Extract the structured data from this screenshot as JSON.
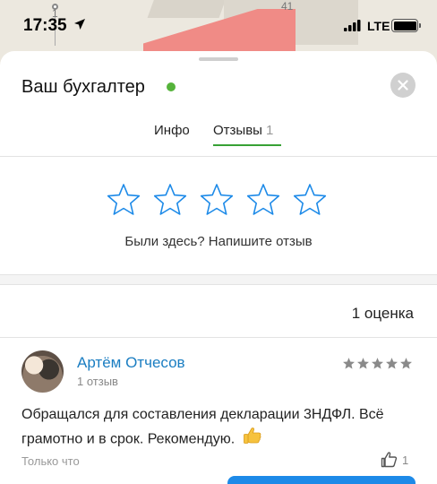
{
  "status_bar": {
    "time": "17:35",
    "network": "LTE",
    "battery_level": 1.0
  },
  "map": {
    "house_numbers": [
      "1",
      "41"
    ]
  },
  "sheet": {
    "title": "Ваш бухгалтер",
    "online_color": "#55b33b"
  },
  "tabs": [
    {
      "label": "Инфо"
    },
    {
      "label": "Отзывы",
      "count": "1",
      "active": true
    }
  ],
  "rate_prompt": {
    "star_count": 5,
    "text": "Были здесь? Напишите отзыв"
  },
  "ratings_summary": "1 оценка",
  "review": {
    "author": "Артём Отчесов",
    "author_sub": "1 отзыв",
    "stars": 5,
    "text": "Обращался для составления декларации 3НДФЛ. Всё грамотно и в срок. Рекомендую.",
    "time": "Только что",
    "likes": "1"
  },
  "colors": {
    "accent_green": "#37a135",
    "link_blue": "#1b7ec2",
    "star_outline": "#1d8ae8"
  }
}
